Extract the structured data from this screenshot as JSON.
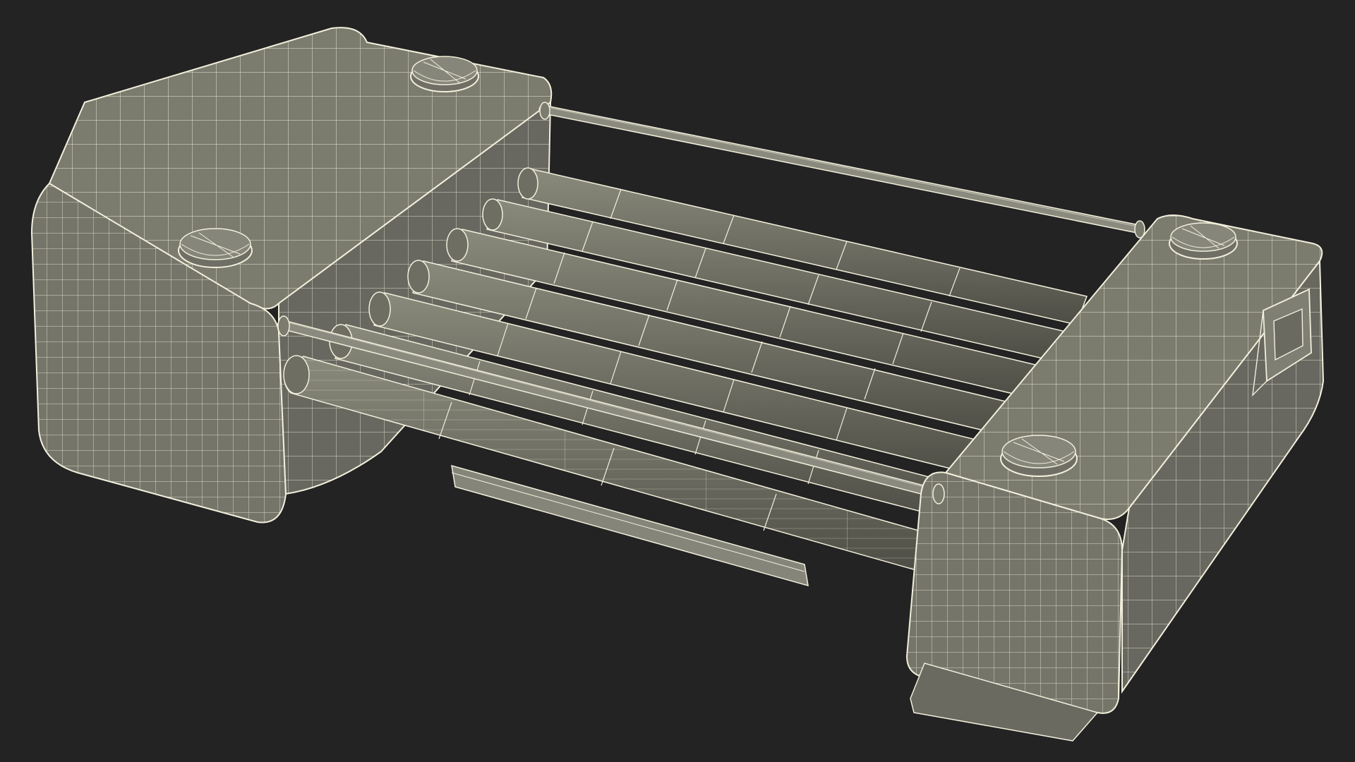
{
  "scene": {
    "subject": "hot-dog-roller-grill-wireframe-render",
    "background_color": "#232323",
    "surface_color": "#7b7b6e",
    "surface_shade_color": "#5f5f55",
    "wire_color": "#f2efdc",
    "roller_count": 7,
    "foot_count": 4,
    "visible_text": []
  }
}
